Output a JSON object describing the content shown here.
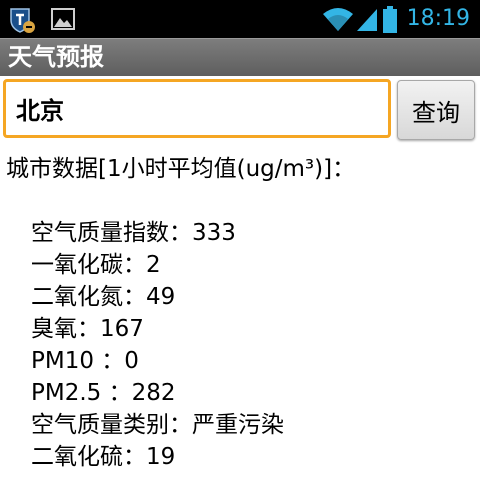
{
  "status_bar": {
    "time": "18:19",
    "icons": [
      "shield-notification-icon",
      "image-notification-icon",
      "wifi-icon",
      "signal-icon",
      "battery-icon"
    ]
  },
  "app": {
    "title": "天气预报"
  },
  "search": {
    "city_value": "北京",
    "query_label": "查询"
  },
  "result": {
    "header": "城市数据[1小时平均值(ug/m³)]：",
    "rows": [
      "空气质量指数：333",
      "一氧化碳：2",
      "二氧化氮：49",
      "臭氧：167",
      "PM10 ：0",
      "PM2.5 ：282",
      "空气质量类别：严重污染",
      "二氧化硫：19"
    ]
  },
  "colors": {
    "status_bar_bg": "#000000",
    "status_accent": "#33b5e5",
    "title_bar_bg": "#6e6e6e",
    "input_focus_border": "#f5a623"
  }
}
